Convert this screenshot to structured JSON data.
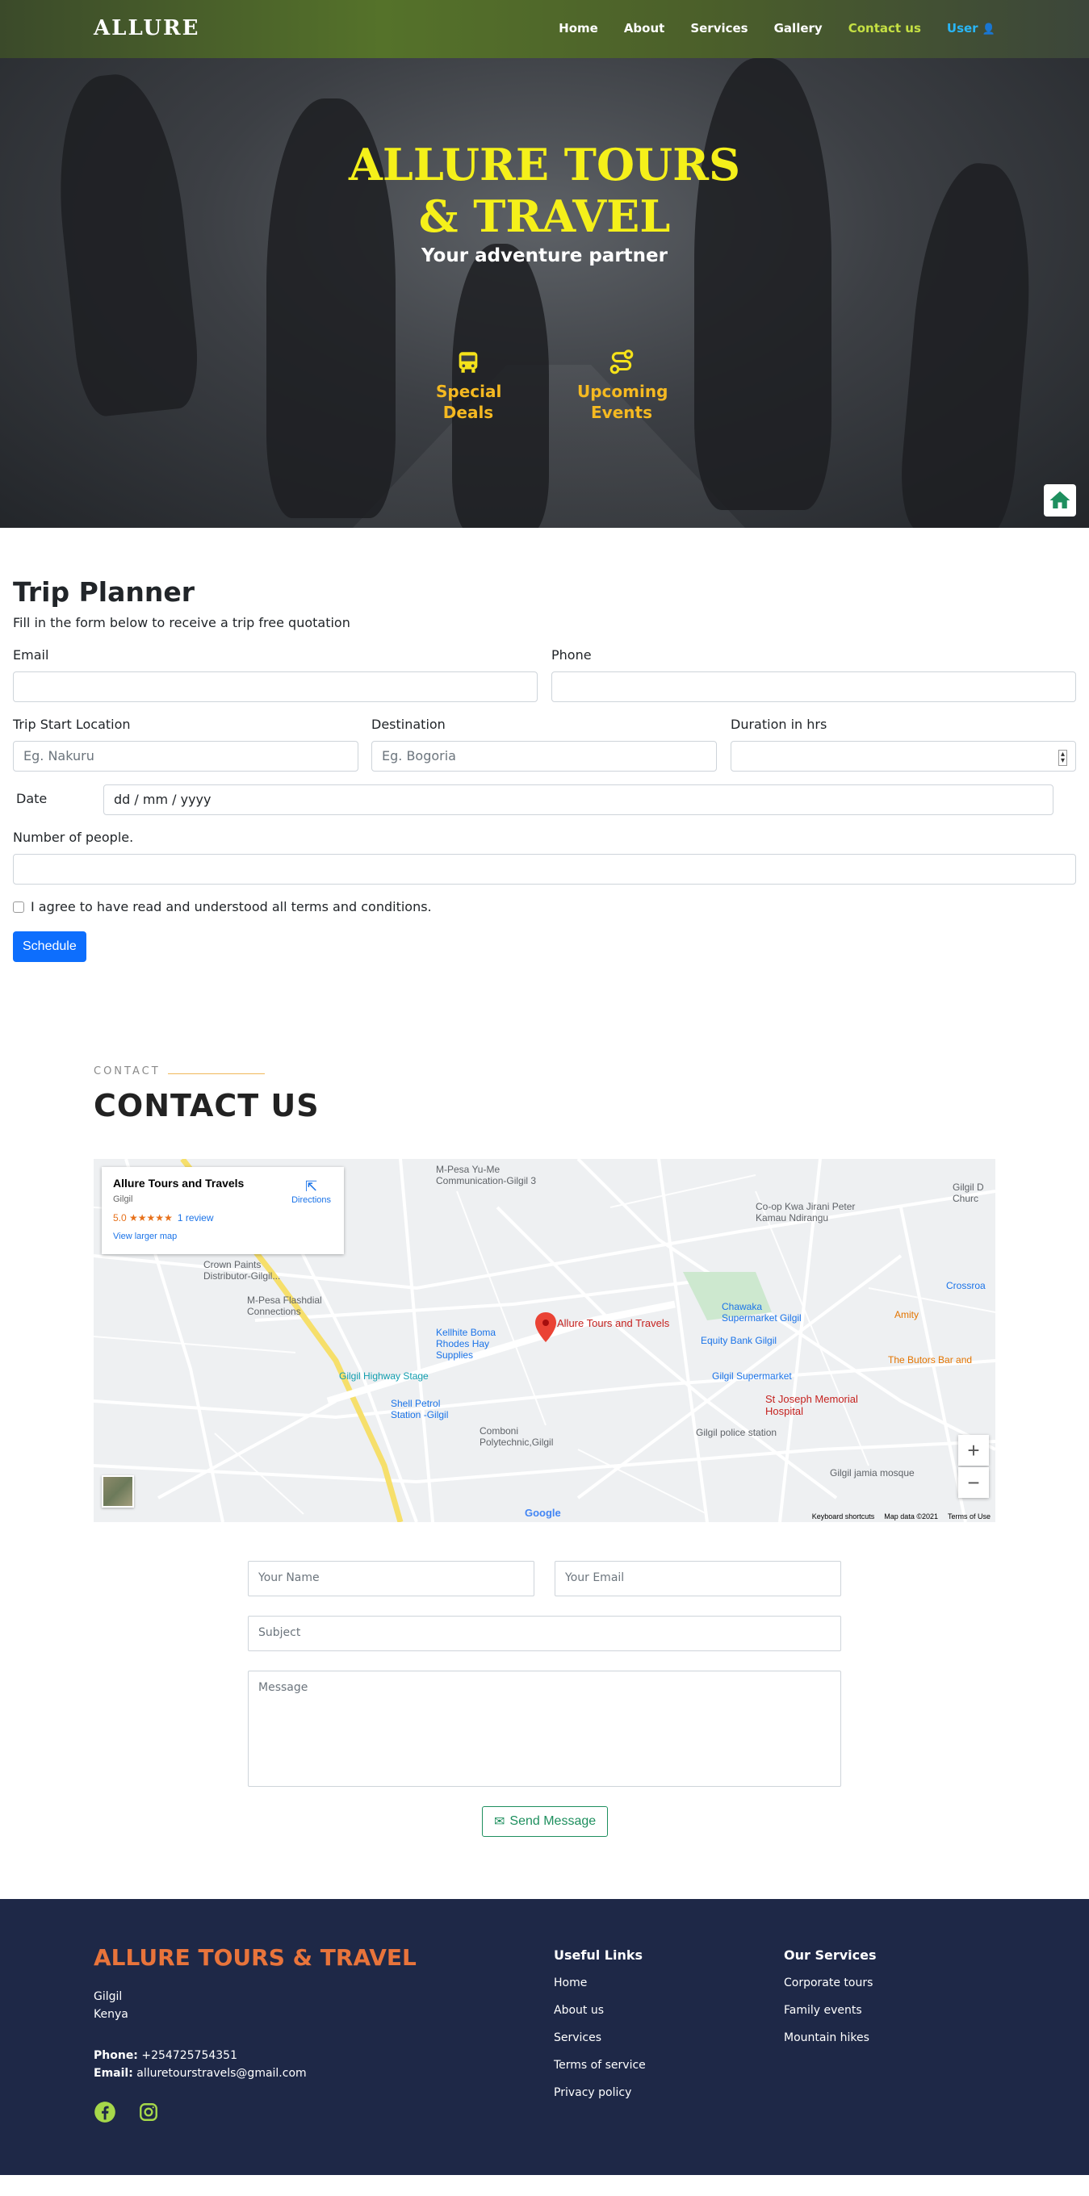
{
  "nav": {
    "brand": "ALLURE",
    "links": [
      "Home",
      "About",
      "Services",
      "Gallery",
      "Contact us",
      "User"
    ]
  },
  "hero": {
    "title": "ALLURE TOURS & TRAVEL",
    "subtitle": "Your adventure partner",
    "features": [
      "Special Deals",
      "Upcoming Events"
    ]
  },
  "planner": {
    "title": "Trip Planner",
    "lead": "Fill in the form below to receive a trip free quotation",
    "email_label": "Email",
    "phone_label": "Phone",
    "start_label": "Trip Start Location",
    "start_placeholder": "Eg. Nakuru",
    "dest_label": "Destination",
    "dest_placeholder": "Eg. Bogoria",
    "duration_label": "Duration in hrs",
    "date_label": "Date",
    "date_placeholder": "dd / mm / yyyy",
    "people_label": "Number of people.",
    "terms_label": "I agree to have read and understood all terms and conditions.",
    "submit_label": "Schedule"
  },
  "contact": {
    "tag": "CONTACT",
    "title": "CONTACT US",
    "map": {
      "place_name": "Allure Tours and Travels",
      "place_town": "Gilgil",
      "rating": "5.0",
      "stars": "★★★★★",
      "reviews": "1 review",
      "larger_map": "View larger map",
      "directions": "Directions",
      "pin_label": "Allure Tours and Travels",
      "labels": {
        "mpesa_yume": "M-Pesa Yu-Me Communication-Gilgil 3",
        "coop": "Co-op Kwa Jirani Peter Kamau Ndirangu",
        "crown": "Crown Paints Distributor-Gilgil...",
        "flashdial": "M-Pesa Flashdial Connections",
        "kellhite": "Kellhite Boma Rhodes Hay Supplies",
        "chawaka": "Chawaka Supermarket Gilgil",
        "equity": "Equity Bank Gilgil",
        "stage": "Gilgil Highway Stage",
        "shell": "Shell Petrol Station -Gilgil",
        "gilgil_super": "Gilgil Supermarket",
        "stjoseph": "St Joseph Memorial Hospital",
        "police": "Gilgil police station",
        "comboni": "Comboni Polytechnic,Gilgil",
        "mosque": "Gilgil jamia mosque",
        "amity": "Amity",
        "butors": "The Butors Bar and",
        "crossroad": "Crossroa",
        "church": "Gilgil D Churc"
      },
      "footer": [
        "Keyboard shortcuts",
        "Map data ©2021",
        "Terms of Use"
      ],
      "google": "Google"
    },
    "form": {
      "name_placeholder": "Your Name",
      "email_placeholder": "Your Email",
      "subject_placeholder": "Subject",
      "message_placeholder": "Message",
      "send_label": "Send Message"
    }
  },
  "footer": {
    "title": "ALLURE TOURS & TRAVEL",
    "address": [
      "Gilgil",
      "Kenya"
    ],
    "phone_label": "Phone:",
    "phone": "+254725754351",
    "email_label": "Email:",
    "email": "alluretourstravels@gmail.com",
    "useful_title": "Useful Links",
    "useful_links": [
      "Home",
      "About us",
      "Services",
      "Terms of service",
      "Privacy policy"
    ],
    "services_title": "Our Services",
    "services": [
      "Corporate tours",
      "Family events",
      "Mountain hikes"
    ]
  },
  "colors": {
    "brand_yellow": "#f5f01a",
    "feature_orange": "#f5b921",
    "footer_bg": "#1e2847",
    "footer_title": "#e8743b",
    "primary": "#0d6efd",
    "send_green": "#1e8f5e",
    "social_green": "#a6d84a"
  }
}
